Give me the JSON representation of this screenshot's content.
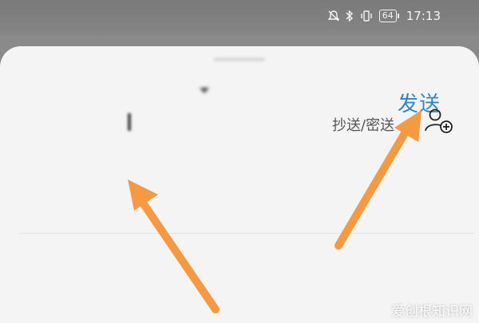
{
  "status_bar": {
    "carrier": "",
    "battery": "64",
    "time": "17:13",
    "icons": [
      "mute-icon",
      "bluetooth-icon",
      "vibrate-icon",
      "battery-icon"
    ]
  },
  "compose": {
    "cancel_label": "",
    "title": "",
    "send_label": "发送",
    "to_field": "",
    "cc_bcc_label": "抄送/密送",
    "contacts": [
      {
        "name": "",
        "email": ""
      },
      {
        "name": "",
        "email": ""
      }
    ]
  },
  "watermark": "爱创根知识网",
  "colors": {
    "accent": "#2f86c8",
    "arrow": "#f59a43",
    "sheet": "#f4f4f4"
  }
}
